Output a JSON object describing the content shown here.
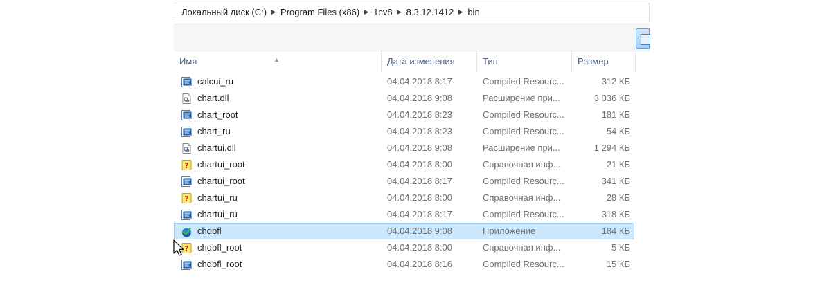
{
  "address_bar": {
    "crumbs": [
      "Локальный диск (C:)",
      "Program Files (x86)",
      "1cv8",
      "8.3.12.1412",
      "bin"
    ]
  },
  "columns": {
    "name": "Имя",
    "date": "Дата изменения",
    "type": "Тип",
    "size": "Размер"
  },
  "files": [
    {
      "name": "calcui_ru",
      "date": "04.04.2018 8:17",
      "type": "Compiled Resourc...",
      "size": "312 КБ",
      "icon": "resource-file-icon"
    },
    {
      "name": "chart.dll",
      "date": "04.04.2018 9:08",
      "type": "Расширение при...",
      "size": "3 036 КБ",
      "icon": "dll-file-icon"
    },
    {
      "name": "chart_root",
      "date": "04.04.2018 8:23",
      "type": "Compiled Resourc...",
      "size": "181 КБ",
      "icon": "resource-file-icon"
    },
    {
      "name": "chart_ru",
      "date": "04.04.2018 8:23",
      "type": "Compiled Resourc...",
      "size": "54 КБ",
      "icon": "resource-file-icon"
    },
    {
      "name": "chartui.dll",
      "date": "04.04.2018 9:08",
      "type": "Расширение при...",
      "size": "1 294 КБ",
      "icon": "dll-file-icon"
    },
    {
      "name": "chartui_root",
      "date": "04.04.2018 8:00",
      "type": "Справочная инф...",
      "size": "21 КБ",
      "icon": "help-file-icon"
    },
    {
      "name": "chartui_root",
      "date": "04.04.2018 8:17",
      "type": "Compiled Resourc...",
      "size": "341 КБ",
      "icon": "resource-file-icon"
    },
    {
      "name": "chartui_ru",
      "date": "04.04.2018 8:00",
      "type": "Справочная инф...",
      "size": "28 КБ",
      "icon": "help-file-icon"
    },
    {
      "name": "chartui_ru",
      "date": "04.04.2018 8:17",
      "type": "Compiled Resourc...",
      "size": "318 КБ",
      "icon": "resource-file-icon"
    },
    {
      "name": "chdbfl",
      "date": "04.04.2018 9:08",
      "type": "Приложение",
      "size": "184 КБ",
      "icon": "app-icon",
      "selected": true
    },
    {
      "name": "chdbfl_root",
      "date": "04.04.2018 8:00",
      "type": "Справочная инф...",
      "size": "5 КБ",
      "icon": "help-file-icon"
    },
    {
      "name": "chdbfl_root",
      "date": "04.04.2018 8:16",
      "type": "Compiled Resourc...",
      "size": "15 КБ",
      "icon": "resource-file-icon"
    }
  ]
}
